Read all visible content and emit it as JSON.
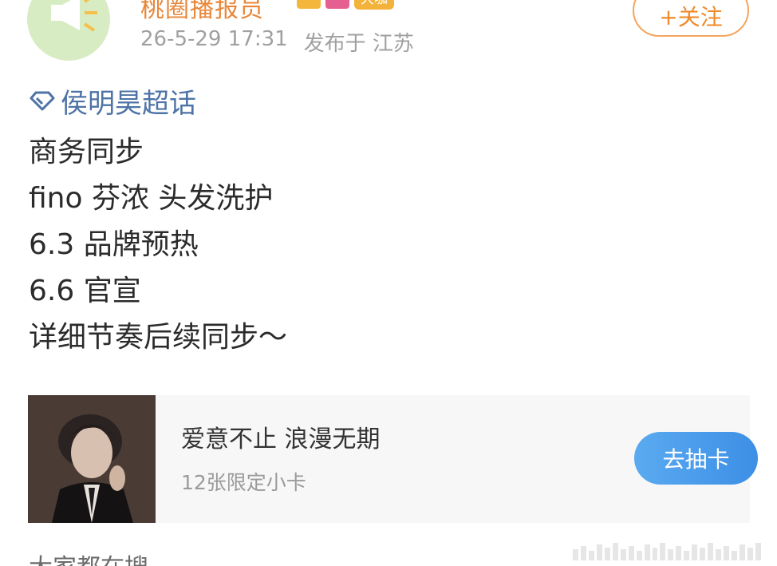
{
  "header": {
    "username": "桃圈播报员",
    "badge_tag": "大咖",
    "timestamp": "26-5-29 17:31",
    "location": "发布于 江苏",
    "follow_label": "+关注"
  },
  "post": {
    "topic": "侯明昊超话",
    "lines": [
      "商务同步",
      "fino 芬浓 头发洗护",
      "6.3 品牌预热",
      "6.6 官宣",
      "详细节奏后续同步～"
    ]
  },
  "card": {
    "title": "爱意不止 浪漫无期",
    "subtitle": "12张限定小卡",
    "button_label": "去抽卡"
  },
  "footer": {
    "label": "大家都在搜"
  },
  "colors": {
    "username": "#e8873a",
    "topic": "#4e73a6",
    "follow_border": "#f4a55c",
    "card_button": "#4a9cec"
  },
  "icons": {
    "avatar": "megaphone-avatar-icon",
    "topic": "diamond-icon"
  }
}
